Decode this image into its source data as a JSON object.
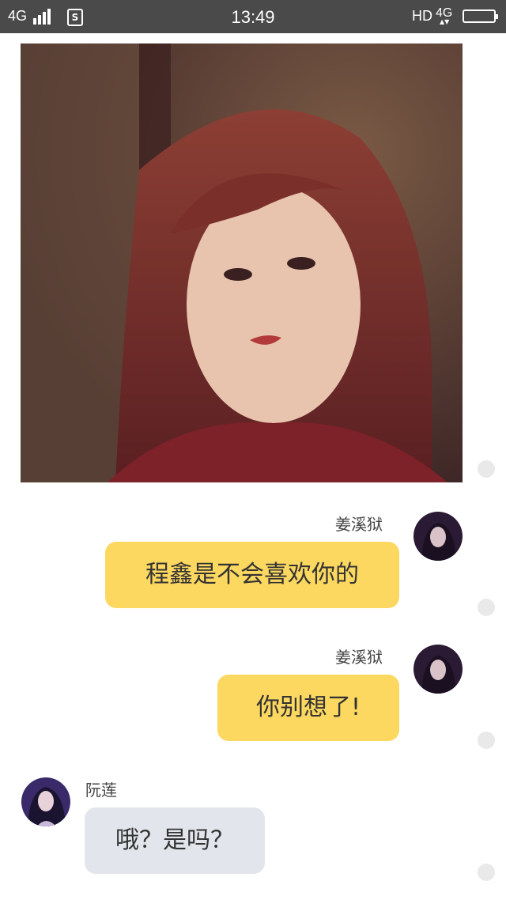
{
  "status_bar": {
    "network_left": "4G",
    "sim_label": "S",
    "time": "13:49",
    "hd": "HD",
    "network_right": "4G"
  },
  "photo": {
    "description_icon": "portrait-photo"
  },
  "messages": [
    {
      "sender": "姜溪狱",
      "text": "程鑫是不会喜欢你的",
      "side": "right",
      "bubble_color": "#fcd860"
    },
    {
      "sender": "姜溪狱",
      "text": "你别想了!",
      "side": "right",
      "bubble_color": "#fcd860"
    },
    {
      "sender": "阮莲",
      "text": "哦？是吗？",
      "side": "left",
      "bubble_color": "#e2e6ec"
    }
  ]
}
